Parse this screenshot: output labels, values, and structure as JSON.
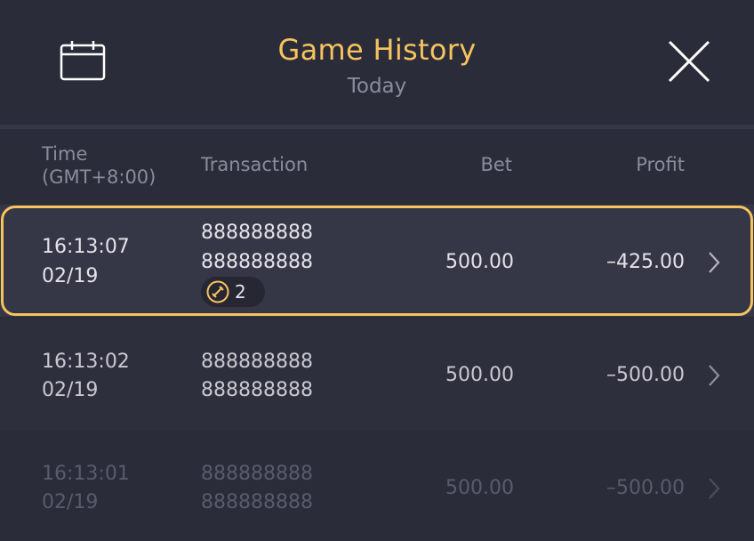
{
  "header": {
    "title": "Game History",
    "subtitle": "Today",
    "calendar_icon": "calendar-icon",
    "close_icon": "close-icon"
  },
  "columns": {
    "time_line1": "Time",
    "time_line2": "(GMT+8:00)",
    "transaction": "Transaction",
    "bet": "Bet",
    "profit": "Profit"
  },
  "rows": [
    {
      "time": "16:13:07",
      "date": "02/19",
      "tx_line1": "888888888",
      "tx_line2": "888888888",
      "bet": "500.00",
      "profit": "–425.00",
      "badge_icon": "sword-icon",
      "badge_count": "2",
      "selected": true
    },
    {
      "time": "16:13:02",
      "date": "02/19",
      "tx_line1": "888888888",
      "tx_line2": "888888888",
      "bet": "500.00",
      "profit": "–500.00"
    },
    {
      "time": "16:13:01",
      "date": "02/19",
      "tx_line1": "888888888",
      "tx_line2": "888888888",
      "bet": "500.00",
      "profit": "–500.00"
    }
  ],
  "colors": {
    "accent": "#f6c35e",
    "background": "#2b2c39",
    "muted_text": "#8b8c9b"
  }
}
